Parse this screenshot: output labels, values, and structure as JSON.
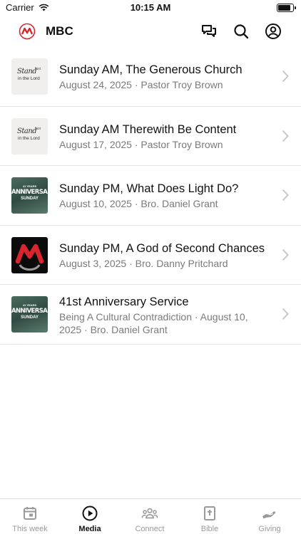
{
  "status_bar": {
    "carrier": "Carrier",
    "time": "10:15 AM",
    "battery_level": 0.9
  },
  "header": {
    "title": "MBC",
    "accent": "#d7262e"
  },
  "sermons": [
    {
      "title": "Sunday AM, The Generous Church",
      "subtitle": "August 24, 2025 · Pastor Troy Brown",
      "thumb": "stand"
    },
    {
      "title": "Sunday AM Therewith Be Content",
      "subtitle": "August 17, 2025 · Pastor Troy Brown",
      "thumb": "stand"
    },
    {
      "title": "Sunday PM, What Does Light Do?",
      "subtitle": "August 10, 2025 · Bro. Daniel Grant",
      "thumb": "anniversary"
    },
    {
      "title": "Sunday PM, A God of Second Chances",
      "subtitle": "August 3, 2025 · Bro. Danny Pritchard",
      "thumb": "logo"
    },
    {
      "title": "41st Anniversary Service",
      "subtitle": "Being A Cultural Contradiction · August 10, 2025 · Bro. Daniel Grant",
      "thumb": "anniversary"
    }
  ],
  "thumbs": {
    "stand": {
      "line1": "Stand",
      "line2": "fast",
      "line3": "in the Lord"
    },
    "anniversary": {
      "line1": "41 YEARS",
      "line2": "ANNIVERSARY",
      "line3": "SUNDAY"
    }
  },
  "tabs": [
    {
      "label": "This week",
      "icon": "calendar-icon",
      "active": false
    },
    {
      "label": "Media",
      "icon": "play-circle-icon",
      "active": true
    },
    {
      "label": "Connect",
      "icon": "people-icon",
      "active": false
    },
    {
      "label": "Bible",
      "icon": "bible-icon",
      "active": false
    },
    {
      "label": "Giving",
      "icon": "giving-hand-icon",
      "active": false
    }
  ]
}
